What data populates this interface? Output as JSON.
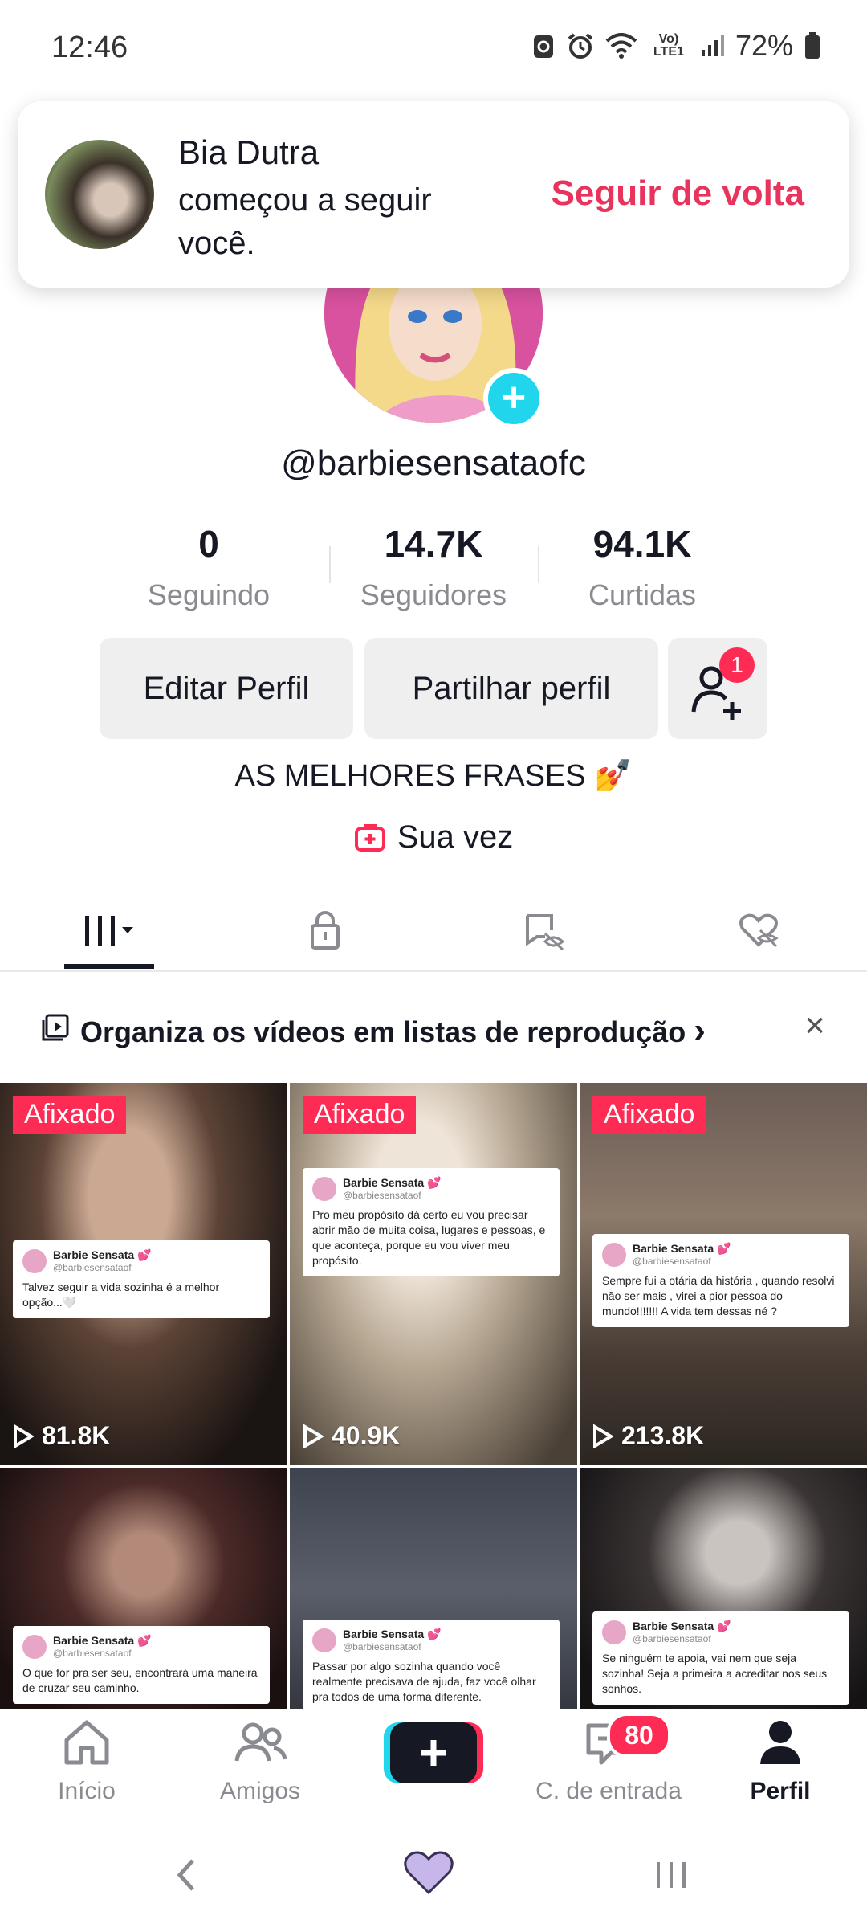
{
  "status_bar": {
    "time": "12:46",
    "network": "Vo) LTE1",
    "battery": "72%"
  },
  "notification": {
    "name": "Bia Dutra",
    "text": "começou a seguir você.",
    "action": "Seguir de volta"
  },
  "profile": {
    "username": "@barbiesensataofc",
    "stats": [
      {
        "value": "0",
        "label": "Seguindo"
      },
      {
        "value": "14.7K",
        "label": "Seguidores"
      },
      {
        "value": "94.1K",
        "label": "Curtidas"
      }
    ],
    "edit_button": "Editar Perfil",
    "share_button": "Partilhar perfil",
    "friend_requests_badge": "1",
    "bio": "AS MELHORES FRASES 💅",
    "link_label": "Sua vez"
  },
  "tabs": [
    {
      "icon": "grid-icon",
      "active": true
    },
    {
      "icon": "lock-icon",
      "active": false
    },
    {
      "icon": "hidden-reposts-icon",
      "active": false
    },
    {
      "icon": "hidden-likes-icon",
      "active": false
    }
  ],
  "playlist_banner": {
    "text": "Organiza os vídeos em listas de reprodução",
    "chevron": "›"
  },
  "videos": [
    {
      "pinned": "Afixado",
      "views": "81.8K",
      "tweet_name": "Barbie Sensata 💕",
      "tweet_handle": "@barbiesensataof",
      "tweet_text": "Talvez seguir a vida sozinha é a melhor opção...🤍"
    },
    {
      "pinned": "Afixado",
      "views": "40.9K",
      "tweet_name": "Barbie Sensata 💕",
      "tweet_handle": "@barbiesensataof",
      "tweet_text": "Pro meu propósito dá certo eu vou precisar abrir mão de muita coisa, lugares e pessoas, e que aconteça, porque eu vou viver meu propósito."
    },
    {
      "pinned": "Afixado",
      "views": "213.8K",
      "tweet_name": "Barbie Sensata 💕",
      "tweet_handle": "@barbiesensataof",
      "tweet_text": "Sempre fui a otária da história , quando resolvi não ser mais , virei a pior pessoa do mundo!!!!!!! A vida tem dessas né ?"
    },
    {
      "pinned": "",
      "views": "",
      "tweet_name": "Barbie Sensata 💕",
      "tweet_handle": "@barbiesensataof",
      "tweet_text": "O que for pra ser seu, encontrará uma maneira de cruzar seu caminho."
    },
    {
      "pinned": "",
      "views": "",
      "tweet_name": "Barbie Sensata 💕",
      "tweet_handle": "@barbiesensataof",
      "tweet_text": "Passar por algo sozinha quando você realmente precisava de ajuda, faz você olhar pra todos de uma forma diferente."
    },
    {
      "pinned": "",
      "views": "",
      "tweet_name": "Barbie Sensata 💕",
      "tweet_handle": "@barbiesensataof",
      "tweet_text": "Se ninguém te apoia, vai nem que seja sozinha! Seja a primeira a acreditar nos seus sonhos."
    }
  ],
  "bottom_nav": {
    "home": "Início",
    "friends": "Amigos",
    "inbox": "C. de entrada",
    "inbox_badge": "80",
    "profile": "Perfil"
  },
  "colors": {
    "accent": "#fe2c55",
    "cyan": "#20d5ec",
    "text": "#161823",
    "muted": "#8a8b91"
  }
}
